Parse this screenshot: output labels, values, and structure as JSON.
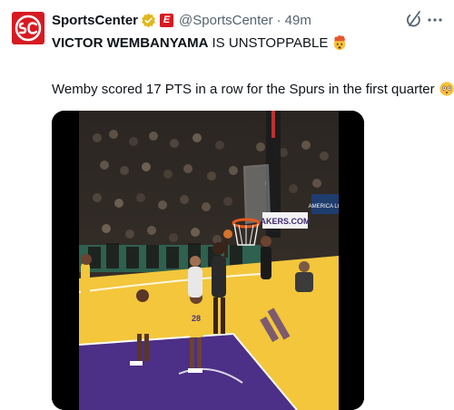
{
  "author": {
    "display_name": "SportsCenter",
    "handle": "@SportsCenter",
    "separator": "·",
    "timestamp": "49m",
    "avatar_icon": "sportscenter-logo",
    "badge_icon": "espn-affiliate-badge",
    "badge_text": "E",
    "verified_icon": "gold-verified-check-icon"
  },
  "post": {
    "headline_bold": "VICTOR WEMBANYAMA",
    "headline_rest": "IS UNSTOPPABLE",
    "headline_emoji": "exploding-head-emoji",
    "body": "Wemby scored 17 PTS in a row for the Spurs in the first quarter",
    "body_emoji": "flushed-face-emoji"
  },
  "media": {
    "type": "video",
    "description_icon": "basketball-game-frame",
    "signage_text": "AKERS.COM",
    "jersey_number": "28",
    "score_screen_text": "AMERICA LO"
  },
  "actions": {
    "grok_icon": "grok-icon",
    "more_icon": "more-options-icon"
  },
  "colors": {
    "brand_red": "#d71a21",
    "verified_gold": "#e2b719",
    "text_primary": "#0f1419",
    "text_secondary": "#536471",
    "court_gold": "#f3c63b",
    "court_purple": "#4c2f86"
  }
}
